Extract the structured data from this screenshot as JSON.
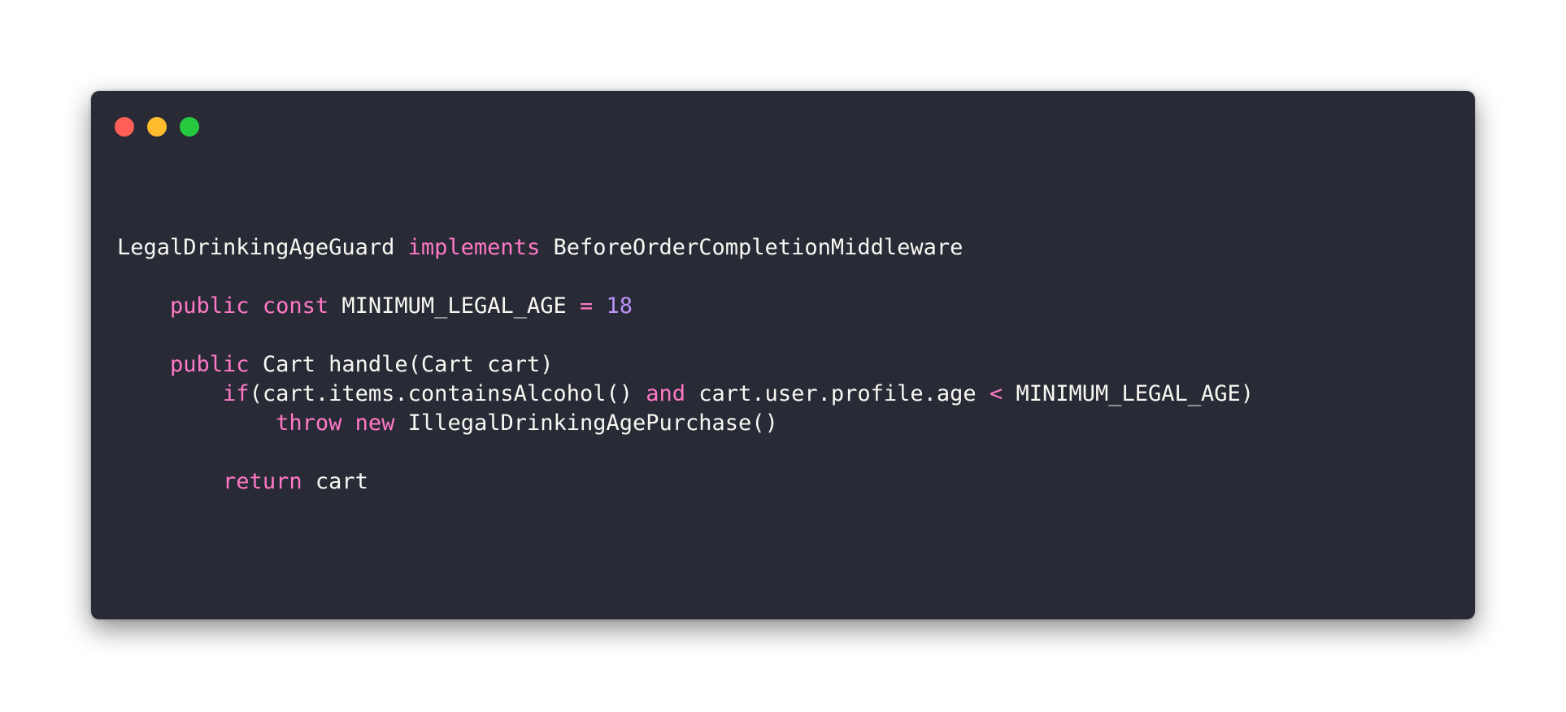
{
  "window_controls": {
    "close_color": "#ff5f56",
    "minimize_color": "#ffbd2e",
    "maximize_color": "#27c93f"
  },
  "theme": {
    "background": "#282a36",
    "text": "#f8f8f2",
    "keyword": "#ff79c6",
    "number": "#bd93f9"
  },
  "code": {
    "line1": {
      "class_name": "LegalDrinkingAgeGuard",
      "implements_kw": "implements",
      "interface_name": "BeforeOrderCompletionMiddleware"
    },
    "line2": {
      "public_kw": "public",
      "const_kw": "const",
      "const_name": "MINIMUM_LEGAL_AGE",
      "equals": "=",
      "value": "18"
    },
    "line3": {
      "public_kw": "public",
      "signature": "Cart handle(Cart cart)"
    },
    "line4": {
      "if_kw": "if",
      "condition_left": "(cart.items.containsAlcohol()",
      "and_kw": "and",
      "condition_mid": "cart.user.profile.age",
      "lt": "<",
      "condition_right": "MINIMUM_LEGAL_AGE)"
    },
    "line5": {
      "throw_kw": "throw",
      "new_kw": "new",
      "exception": "IllegalDrinkingAgePurchase()"
    },
    "line6": {
      "return_kw": "return",
      "return_value": "cart"
    }
  }
}
